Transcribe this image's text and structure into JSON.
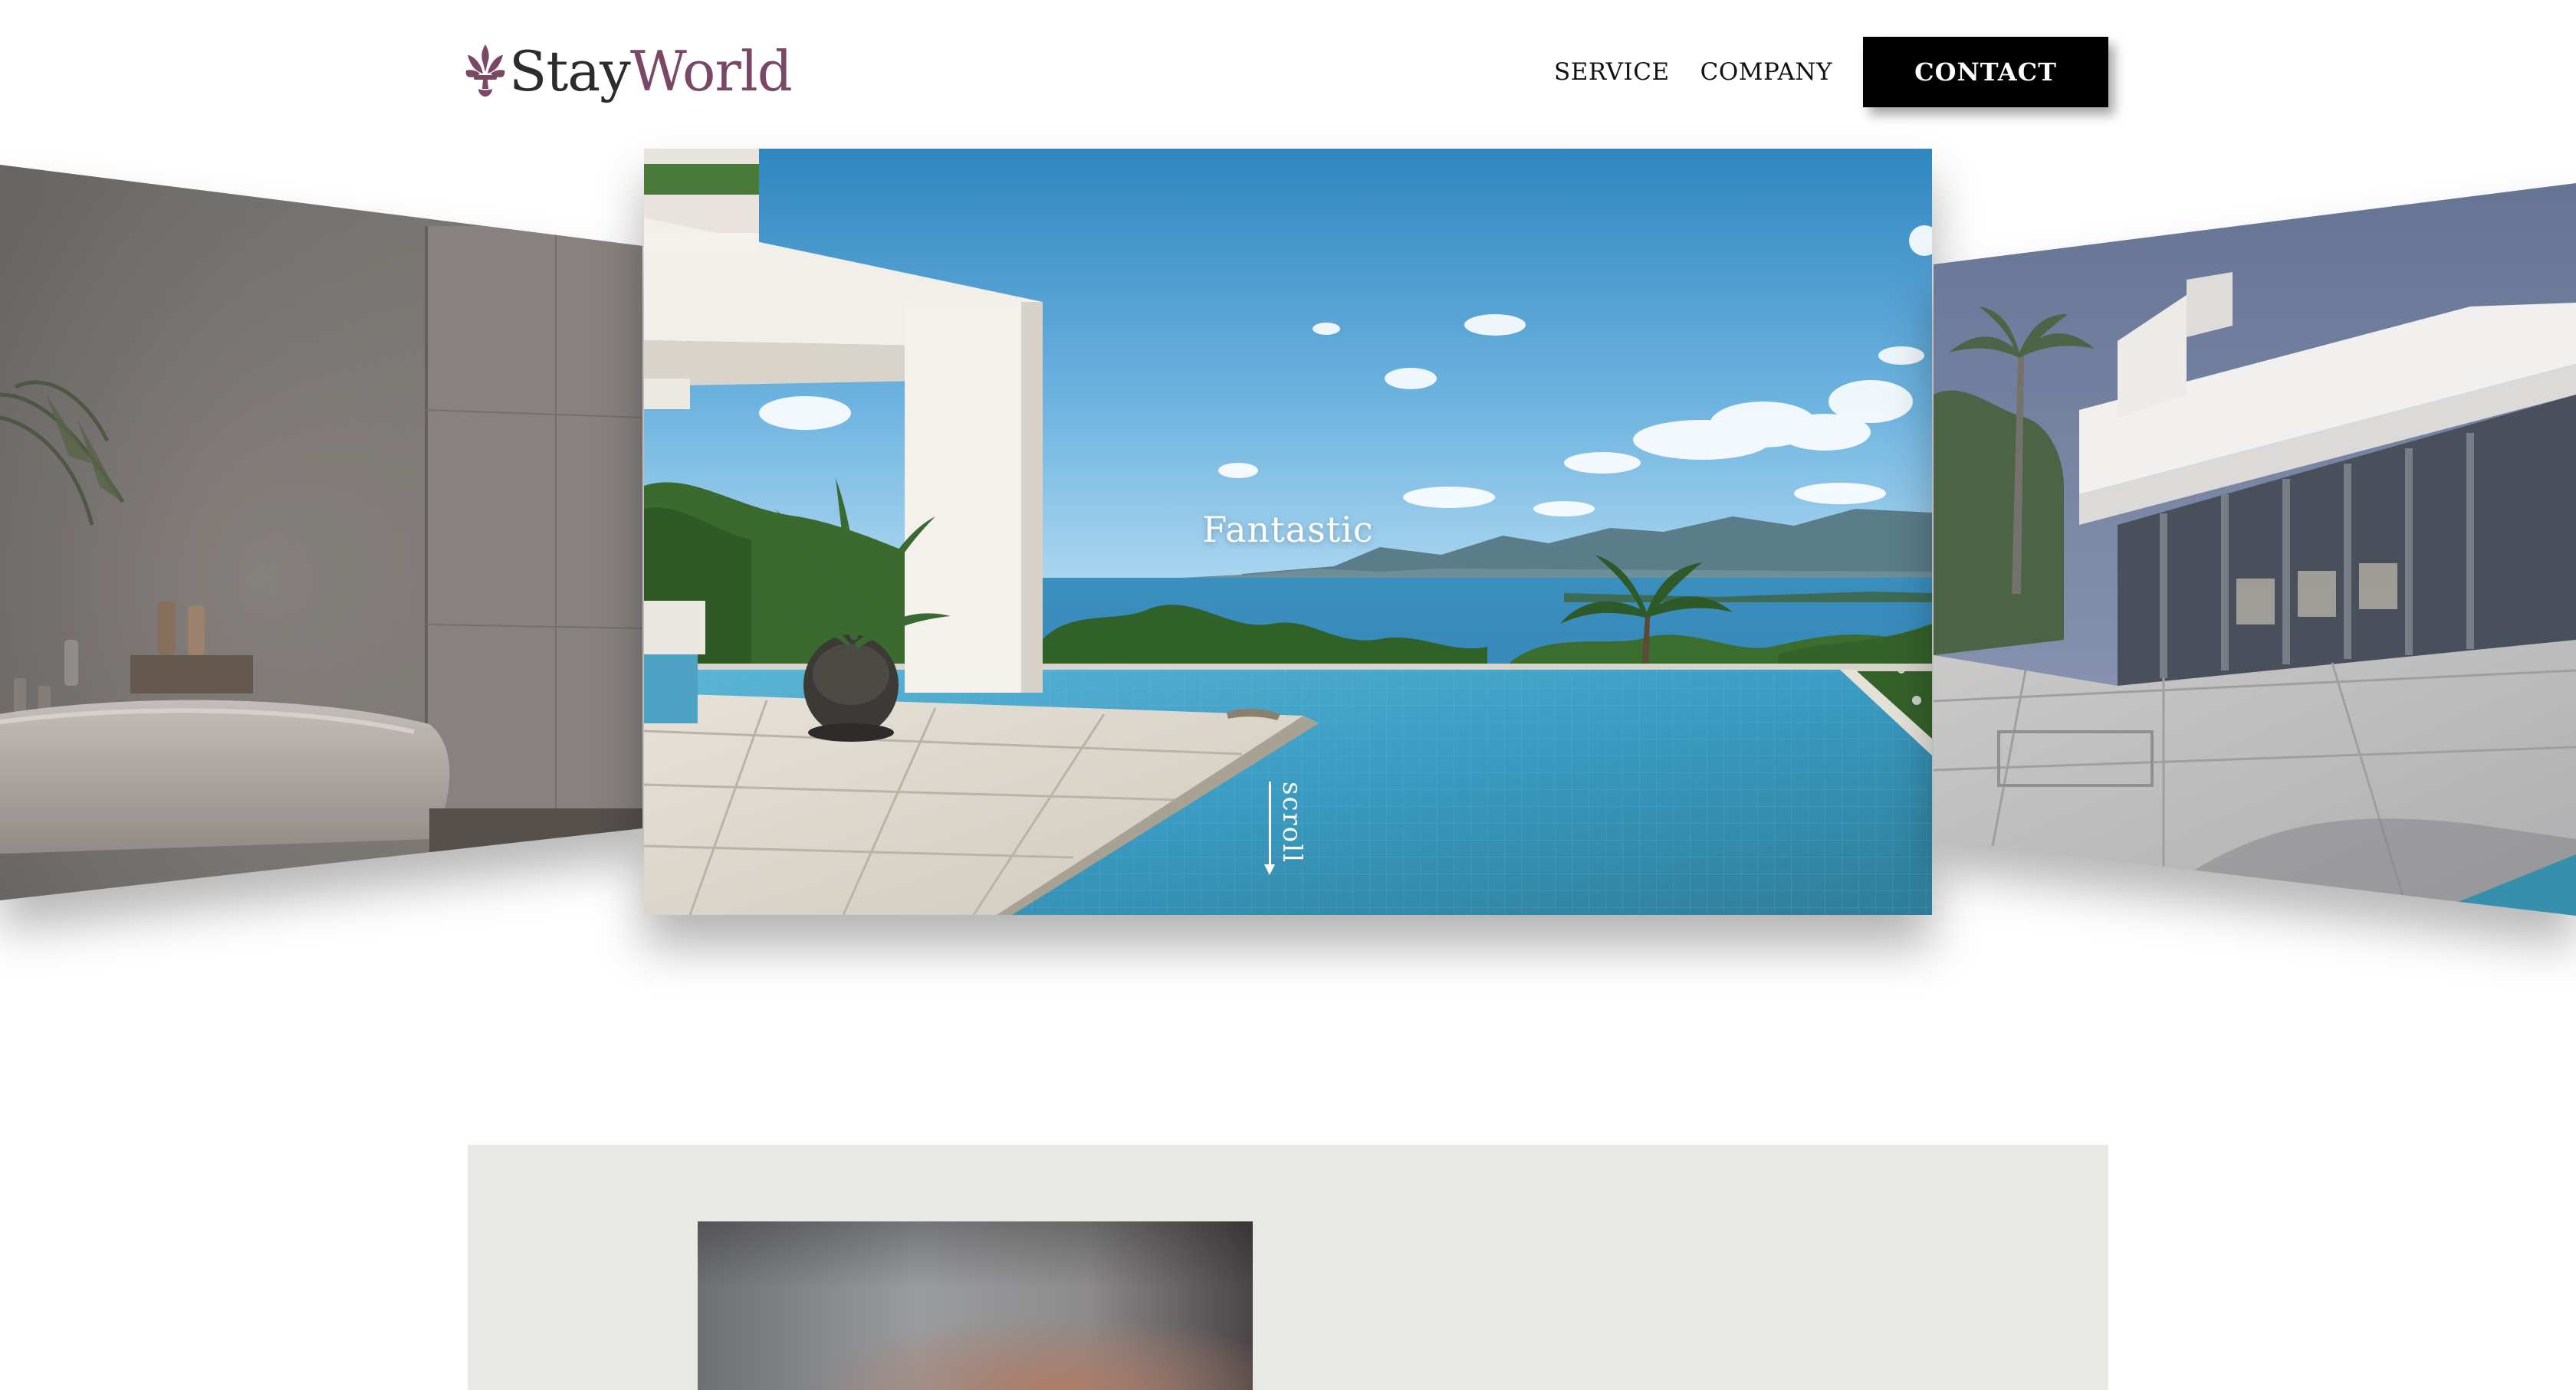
{
  "brand": {
    "name_part1": "Stay",
    "name_part2": "World",
    "primary_color": "#7a4766",
    "text_color": "#2c2c2c"
  },
  "nav": {
    "links": [
      "SERVICE",
      "COMPANY"
    ],
    "contact_label": "CONTACT"
  },
  "hero": {
    "title": "Fantastic",
    "scroll_label": "scroll"
  },
  "lower_section": {
    "background": "#e8e8e4"
  },
  "icons": {
    "logo": "fleur-de-lis-icon",
    "scroll": "arrow-down-icon"
  }
}
